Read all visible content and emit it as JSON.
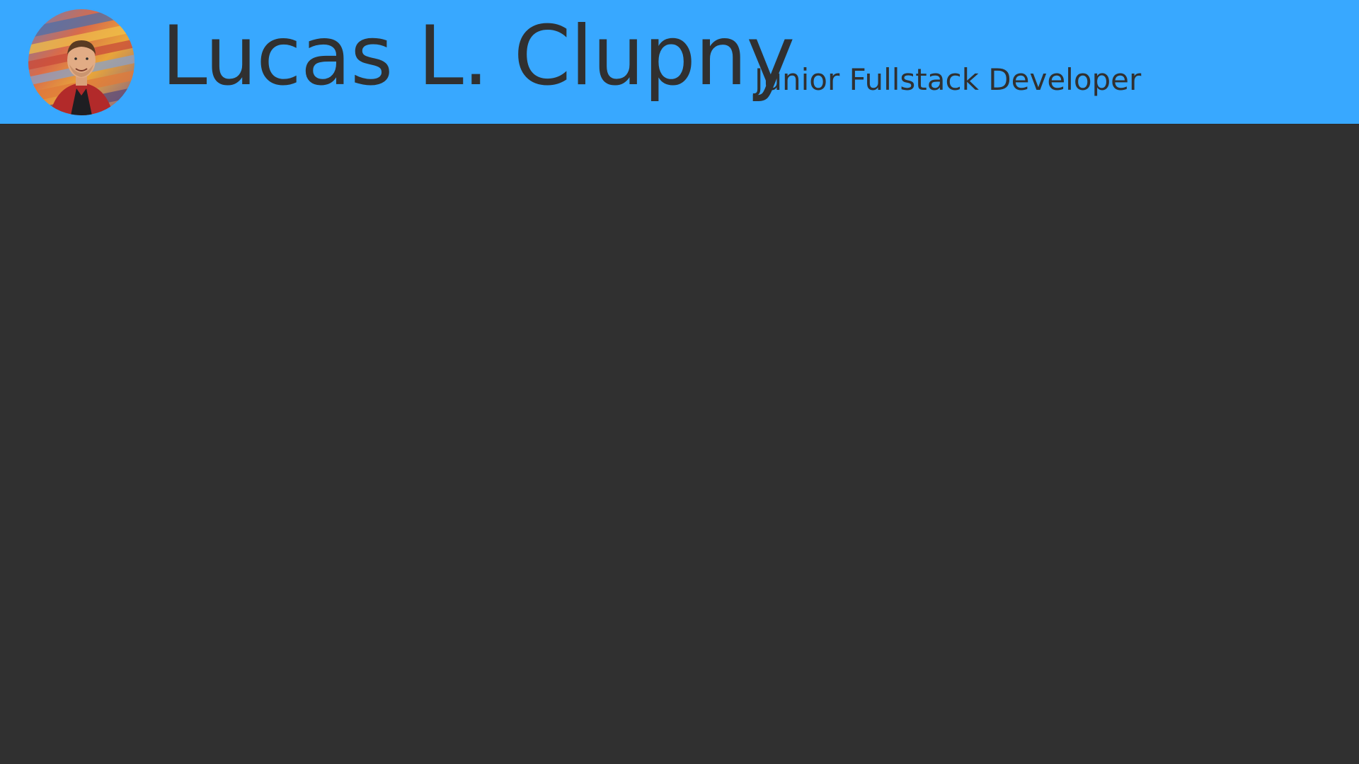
{
  "header": {
    "name": "Lucas L. Clupny",
    "role": "Junior Fullstack Developer",
    "background_color": "#38a8ff",
    "text_color": "#303030",
    "avatar": {
      "icon": "profile-photo",
      "description_shape": "circle"
    }
  },
  "main": {
    "background_color": "#303030"
  }
}
